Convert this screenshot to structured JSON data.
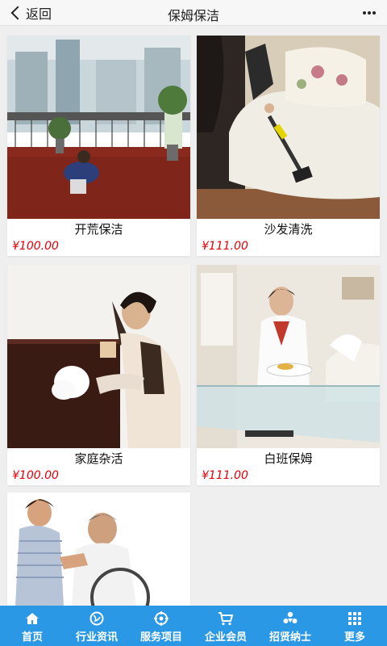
{
  "header": {
    "back_label": "返回",
    "title": "保姆保洁"
  },
  "products": [
    {
      "name": "开荒保洁",
      "price": "¥100.00",
      "image": "woman-cleaning-floor-photo"
    },
    {
      "name": "沙发清洗",
      "price": "¥111.00",
      "image": "vacuuming-sofa-photo"
    },
    {
      "name": "家庭杂活",
      "price": "¥100.00",
      "image": "woman-wiping-wall-photo"
    },
    {
      "name": "白班保姆",
      "price": "¥111.00",
      "image": "maid-wiping-table-photo"
    },
    {
      "name": "",
      "price": "",
      "image": "caregiver-wheelchair-photo"
    }
  ],
  "tabbar": [
    {
      "label": "首页",
      "icon": "home-icon"
    },
    {
      "label": "行业资讯",
      "icon": "globe-icon"
    },
    {
      "label": "服务项目",
      "icon": "target-icon"
    },
    {
      "label": "企业会员",
      "icon": "cart-icon"
    },
    {
      "label": "招贤纳士",
      "icon": "people-icon"
    },
    {
      "label": "更多",
      "icon": "grid-icon"
    }
  ],
  "colors": {
    "accent": "#2a98e4",
    "price": "#e4000a"
  }
}
